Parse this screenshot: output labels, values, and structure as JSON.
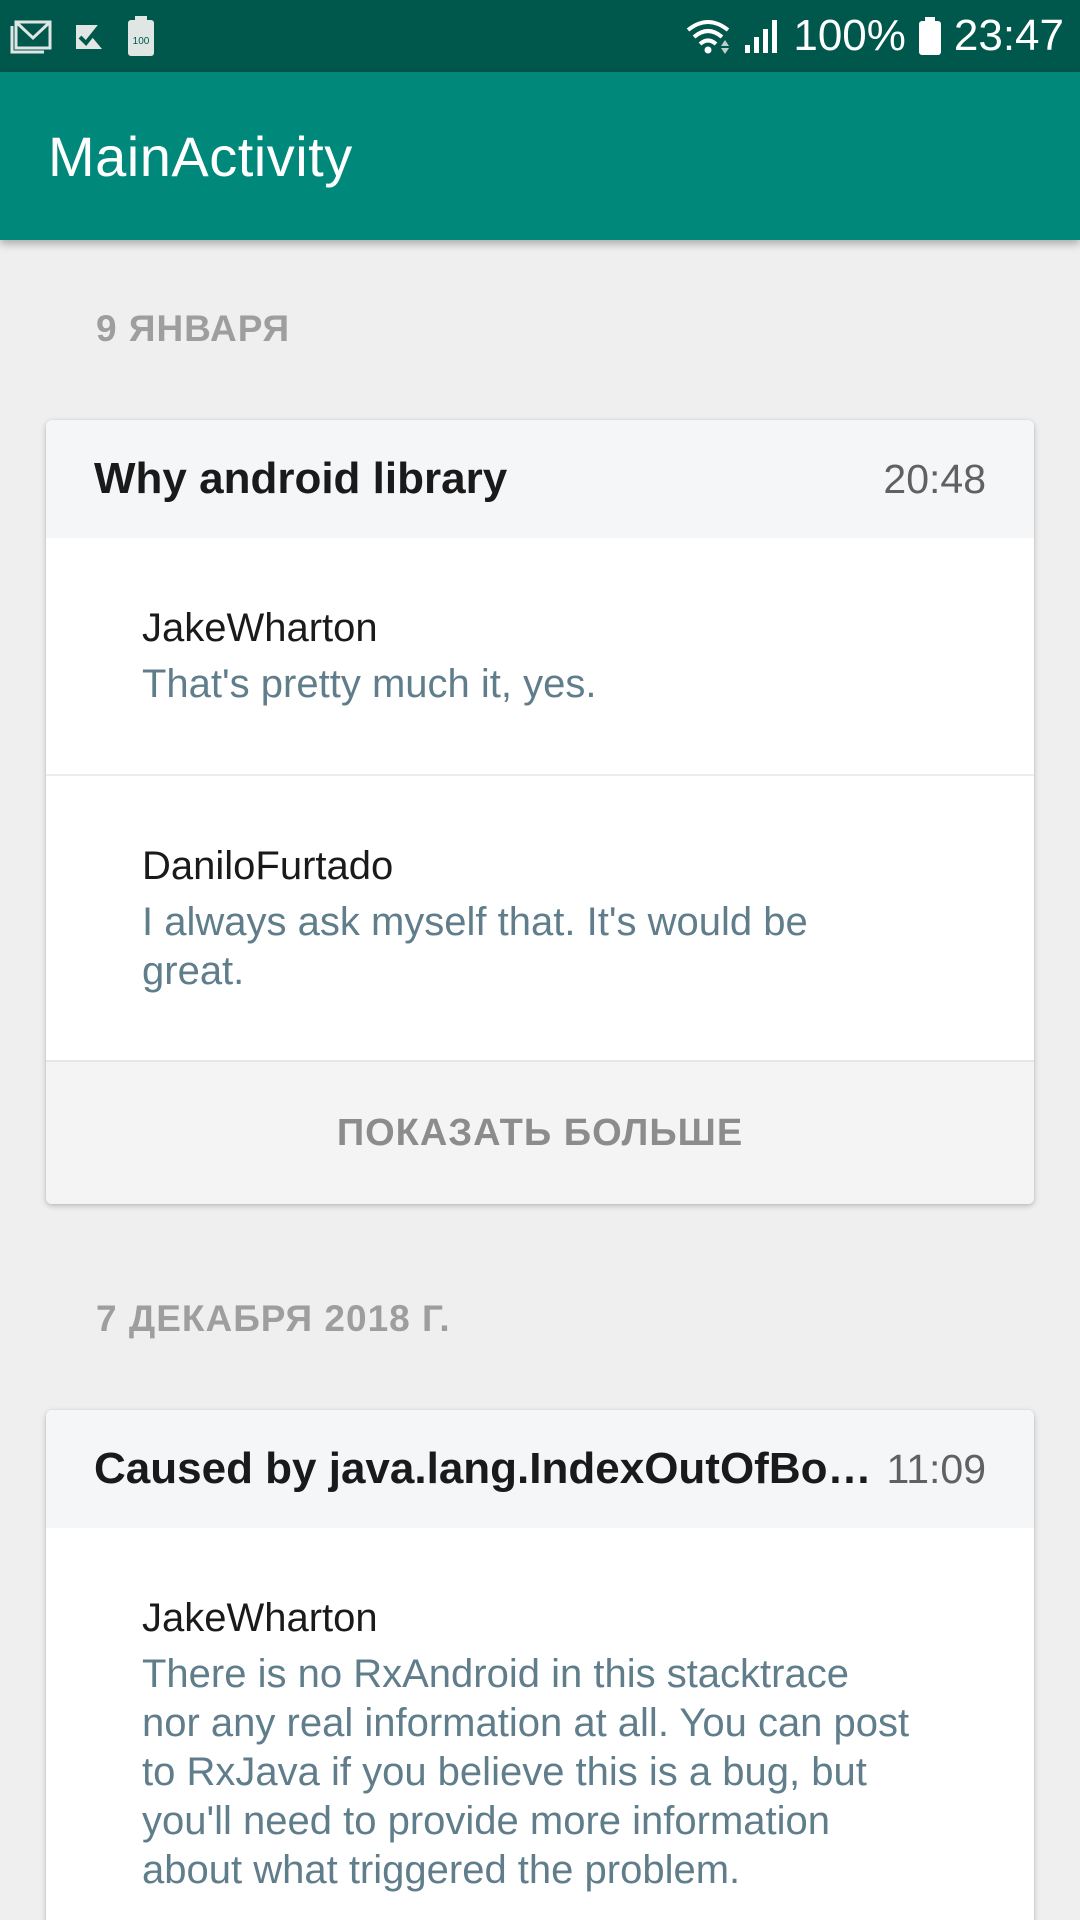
{
  "status_bar": {
    "left_icons": [
      "gmail-icon",
      "task-check-icon",
      "battery-100-icon"
    ],
    "battery_percent": "100%",
    "time": "23:47",
    "battery_small_label": "100"
  },
  "app_bar": {
    "title": "MainActivity"
  },
  "feed": {
    "groups": [
      {
        "date": "9 ЯНВАРЯ",
        "card": {
          "title": "Why android library",
          "time": "20:48",
          "comments": [
            {
              "author": "JakeWharton",
              "text": "That's pretty much it, yes."
            },
            {
              "author": "DaniloFurtado",
              "text": "I always ask myself that. It's would be great."
            }
          ],
          "show_more": "ПОКАЗАТЬ БОЛЬШЕ"
        }
      },
      {
        "date": "7 ДЕКАБРЯ 2018 Г.",
        "card": {
          "title": "Caused by java.lang.IndexOutOfBoundsException",
          "time": "11:09",
          "comments": [
            {
              "author": "JakeWharton",
              "text": "There is no RxAndroid in this stacktrace nor any real information at all. You can post to RxJava if you believe this is a bug, but you'll need to provide more information about what triggered the problem."
            }
          ]
        }
      }
    ]
  },
  "colors": {
    "status_bar": "#00574b",
    "app_bar": "#00897b",
    "background": "#efefef",
    "comment_text": "#607d8b"
  }
}
